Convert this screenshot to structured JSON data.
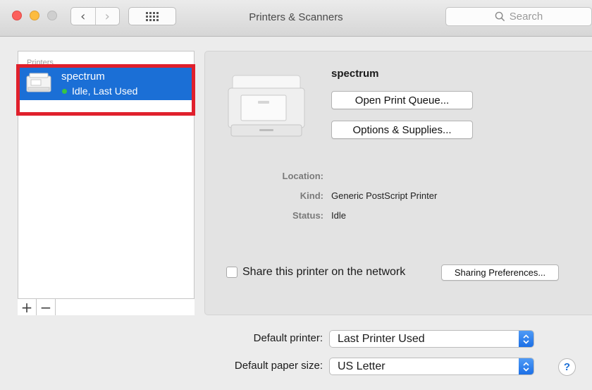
{
  "window": {
    "title": "Printers & Scanners",
    "search_placeholder": "Search",
    "back_glyph": "‹",
    "forward_glyph": "›"
  },
  "printer_list": {
    "header": "Printers",
    "items": [
      {
        "name": "spectrum",
        "status": "Idle, Last Used",
        "selected": true,
        "status_color": "#38c543"
      }
    ],
    "add_label": "+",
    "remove_label": "−"
  },
  "details": {
    "printer_name": "spectrum",
    "open_queue_label": "Open Print Queue...",
    "options_label": "Options & Supplies...",
    "location_label": "Location:",
    "location_value": "",
    "kind_label": "Kind:",
    "kind_value": "Generic PostScript Printer",
    "status_label": "Status:",
    "status_value": "Idle",
    "share_label": "Share this printer on the network",
    "share_checked": false,
    "sharing_prefs_label": "Sharing Preferences..."
  },
  "defaults": {
    "printer_label": "Default printer:",
    "printer_value": "Last Printer Used",
    "paper_label": "Default paper size:",
    "paper_value": "US Letter"
  },
  "help_label": "?",
  "colors": {
    "selection": "#1b6fd6",
    "highlight_annotation": "#e0202c",
    "popup_arrow": "#1c6fe6"
  }
}
